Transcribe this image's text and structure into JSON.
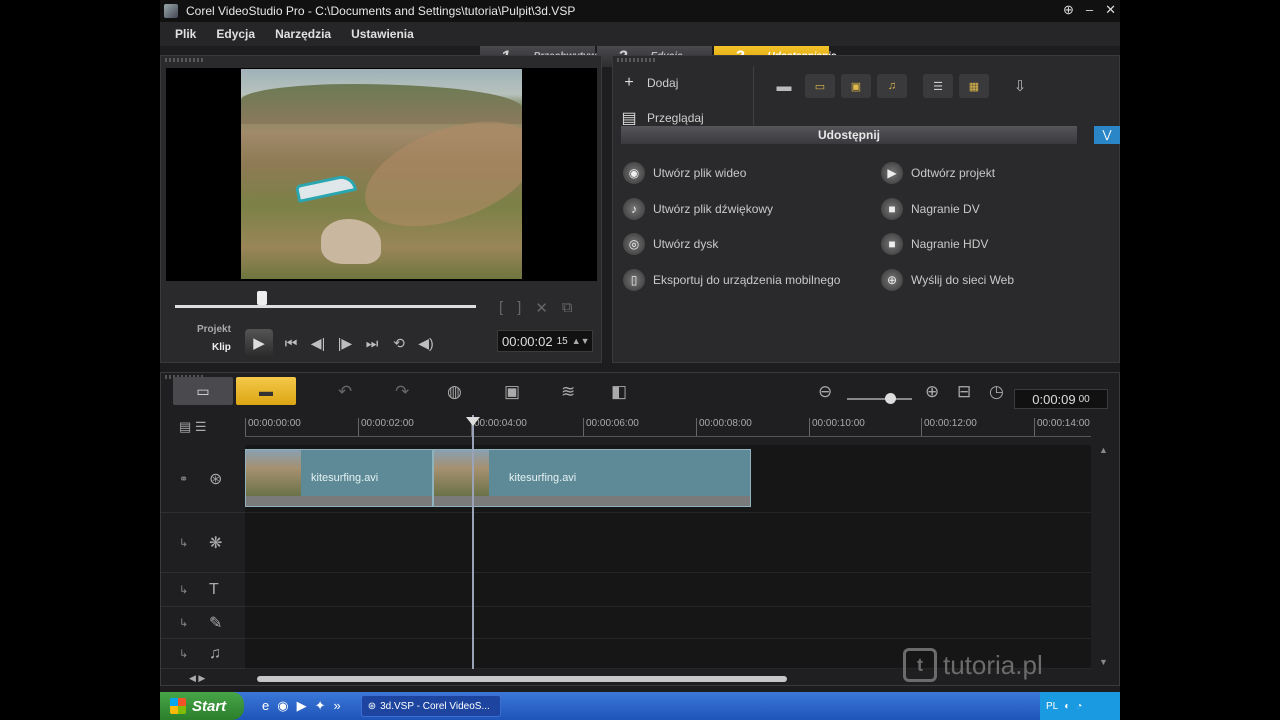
{
  "window": {
    "title": "Corel VideoStudio Pro - C:\\Documents and Settings\\tutoria\\Pulpit\\3d.VSP"
  },
  "menu": [
    "Plik",
    "Edycja",
    "Narzędzia",
    "Ustawienia"
  ],
  "steps": [
    {
      "num": "1",
      "label": "Przechwytywanie"
    },
    {
      "num": "2",
      "label": "Edycja"
    },
    {
      "num": "3",
      "label": "Udostępnianie"
    }
  ],
  "player": {
    "mode_project": "Projekt",
    "mode_clip": "Klip",
    "timecode": "00:00:02",
    "timecode_frames": "15",
    "scrub_fraction": 0.29
  },
  "library": {
    "add_label": "Dodaj",
    "browse_label": "Przeglądaj"
  },
  "share": {
    "header": "Udostępnij",
    "items_left": [
      "Utwórz plik wideo",
      "Utwórz plik dźwiękowy",
      "Utwórz dysk",
      "Eksportuj do urządzenia mobilnego"
    ],
    "items_right": [
      "Odtwórz projekt",
      "Nagranie DV",
      "Nagranie HDV",
      "Wyślij do sieci Web"
    ]
  },
  "timeline": {
    "duration": "0:00:09",
    "duration_frames": "00",
    "ruler": [
      "00:00:00:00",
      "00:00:02:00",
      "00:00:04:00",
      "00:00:06:00",
      "00:00:08:00",
      "00:00:10:00",
      "00:00:12:00",
      "00:00:14:00"
    ],
    "clips": [
      "kitesurfing.avi",
      "kitesurfing.avi"
    ]
  },
  "taskbar": {
    "start": "Start",
    "task": "3d.VSP - Corel VideoS...",
    "lang": "PL"
  },
  "watermark": "tutoria.pl"
}
